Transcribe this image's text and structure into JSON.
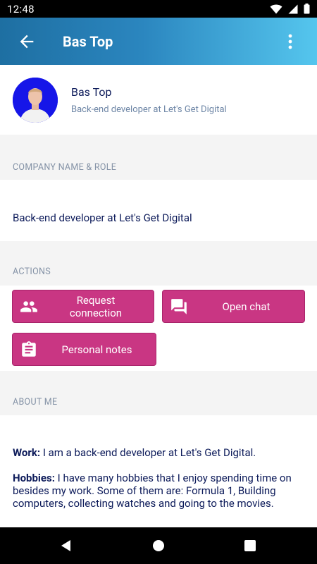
{
  "status_bar": {
    "time": "12:48"
  },
  "app_bar": {
    "title": "Bas Top"
  },
  "profile": {
    "name": "Bas Top",
    "role": "Back-end developer at Let's Get Digital"
  },
  "company_section": {
    "header": "COMPANY NAME & ROLE",
    "value": "Back-end developer at Let's Get Digital"
  },
  "actions_section": {
    "header": "ACTIONS",
    "request_connection": "Request connection",
    "open_chat": "Open chat",
    "personal_notes": "Personal notes"
  },
  "about_section": {
    "header": "ABOUT ME",
    "work_label": "Work:",
    "work_text": " I am a back-end developer at Let's Get Digital.",
    "hobbies_label": "Hobbies:",
    "hobbies_text": " I have many hobbies that I enjoy spending time on besides my work. Some of them are: Formula 1, Building computers, collecting watches and going to the movies."
  },
  "colors": {
    "accent": "#c93683",
    "text_dark": "#0d1b5a",
    "muted": "#8492a6",
    "app_bar_start": "#1e6fa2",
    "app_bar_end": "#55c6ee"
  },
  "icons": {
    "back": "arrow-back-icon",
    "more": "more-vert-icon",
    "request_connection": "people-icon",
    "open_chat": "chat-icon",
    "personal_notes": "clipboard-icon"
  }
}
